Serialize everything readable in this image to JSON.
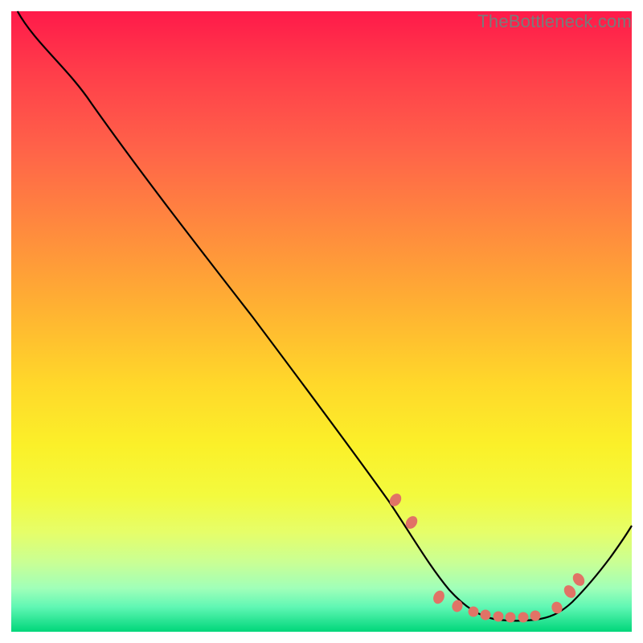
{
  "watermark": "TheBottleneck.com",
  "chart_data": {
    "type": "line",
    "title": "",
    "xlabel": "",
    "ylabel": "",
    "xlim": [
      0,
      100
    ],
    "ylim": [
      0,
      100
    ],
    "series": [
      {
        "name": "curve",
        "x": [
          1,
          10,
          18,
          30,
          40,
          50,
          58,
          62,
          65,
          67,
          69,
          71,
          73,
          75,
          77,
          79,
          81,
          83,
          85,
          87,
          89,
          92,
          95,
          99
        ],
        "y": [
          100,
          92,
          84,
          69,
          56,
          43,
          32,
          25,
          20,
          16,
          12,
          9,
          6,
          4,
          3,
          2,
          2,
          2,
          2,
          3,
          5,
          9,
          13,
          20
        ]
      }
    ],
    "markers": {
      "x": [
        62,
        64.5,
        69,
        72,
        74.5,
        76.5,
        78.5,
        80.5,
        82.5,
        84.5,
        88,
        90,
        91.5
      ],
      "y": [
        22,
        18,
        5.5,
        4.2,
        3.5,
        3.1,
        2.9,
        2.8,
        2.8,
        2.9,
        3.8,
        6.5,
        8.5
      ]
    },
    "gradient_note": "background gradient red (top) to green (bottom) representing bottleneck severity"
  }
}
